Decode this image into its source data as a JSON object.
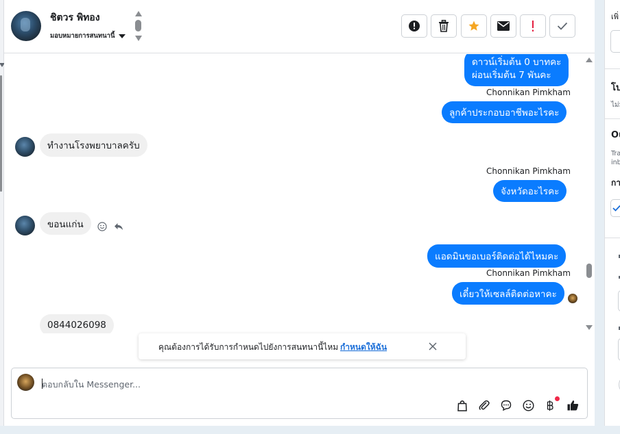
{
  "header": {
    "contact_name": "ชิตวร พิทอง",
    "assign_label": "มอบหมายการสนทนานี้",
    "buttons": [
      {
        "name": "spam-button",
        "icon": "alert-circle-icon"
      },
      {
        "name": "delete-button",
        "icon": "trash-icon"
      },
      {
        "name": "star-button",
        "icon": "star-icon",
        "color": "#f5a623"
      },
      {
        "name": "mark-unread-button",
        "icon": "envelope-icon"
      },
      {
        "name": "follow-up-button",
        "icon": "exclamation-icon",
        "color": "#e41e3f"
      },
      {
        "name": "mark-done-button",
        "icon": "check-icon"
      }
    ]
  },
  "messages": {
    "m1_line1": "ดาวน์เริ่มต้น 0 บาทคะ",
    "m1_line2": "ผ่อนเริ่มต้น 7 พันคะ",
    "sender1": "Chonnikan Pimkham",
    "m2": "ลูกค้าประกอบอาชีพอะไรคะ",
    "m3": "ทำงานโรงพยาบาลครับ",
    "sender2": "Chonnikan Pimkham",
    "m4": "จังหวัดอะไรคะ",
    "m5": "ขอนแก่น",
    "m6": "แอดมินขอเบอร์ติดต่อได้ไหมคะ",
    "sender3": "Chonnikan Pimkham",
    "m7": "เดี๋ยวให้เซลล์ติดต่อหาคะ",
    "m8": "0844026098"
  },
  "toast": {
    "text": "คุณต้องการได้รับการกำหนดไปยังการสนทนานี้ไหม",
    "link": "กำหนดให้ฉัน"
  },
  "composer": {
    "placeholder": "ตอบกลับใน Messenger...",
    "tools": [
      "bag-icon",
      "paperclip-icon",
      "chat-bubble-icon",
      "emoji-icon",
      "baht-icon",
      "thumbs-up-icon"
    ]
  },
  "right_panel": {
    "top_text": "เพิ่",
    "section1_title": "โป",
    "section1_sub": "ไม่ม",
    "section2_title": "Ou",
    "section2_sub1": "Tra",
    "section2_sub2": "inb",
    "section3_title": "กา"
  },
  "colors": {
    "outgoing_bubble": "#0a7cff",
    "incoming_bubble": "#f0f0f0",
    "link": "#1a6ed8",
    "notification_dot": "#f02849"
  }
}
